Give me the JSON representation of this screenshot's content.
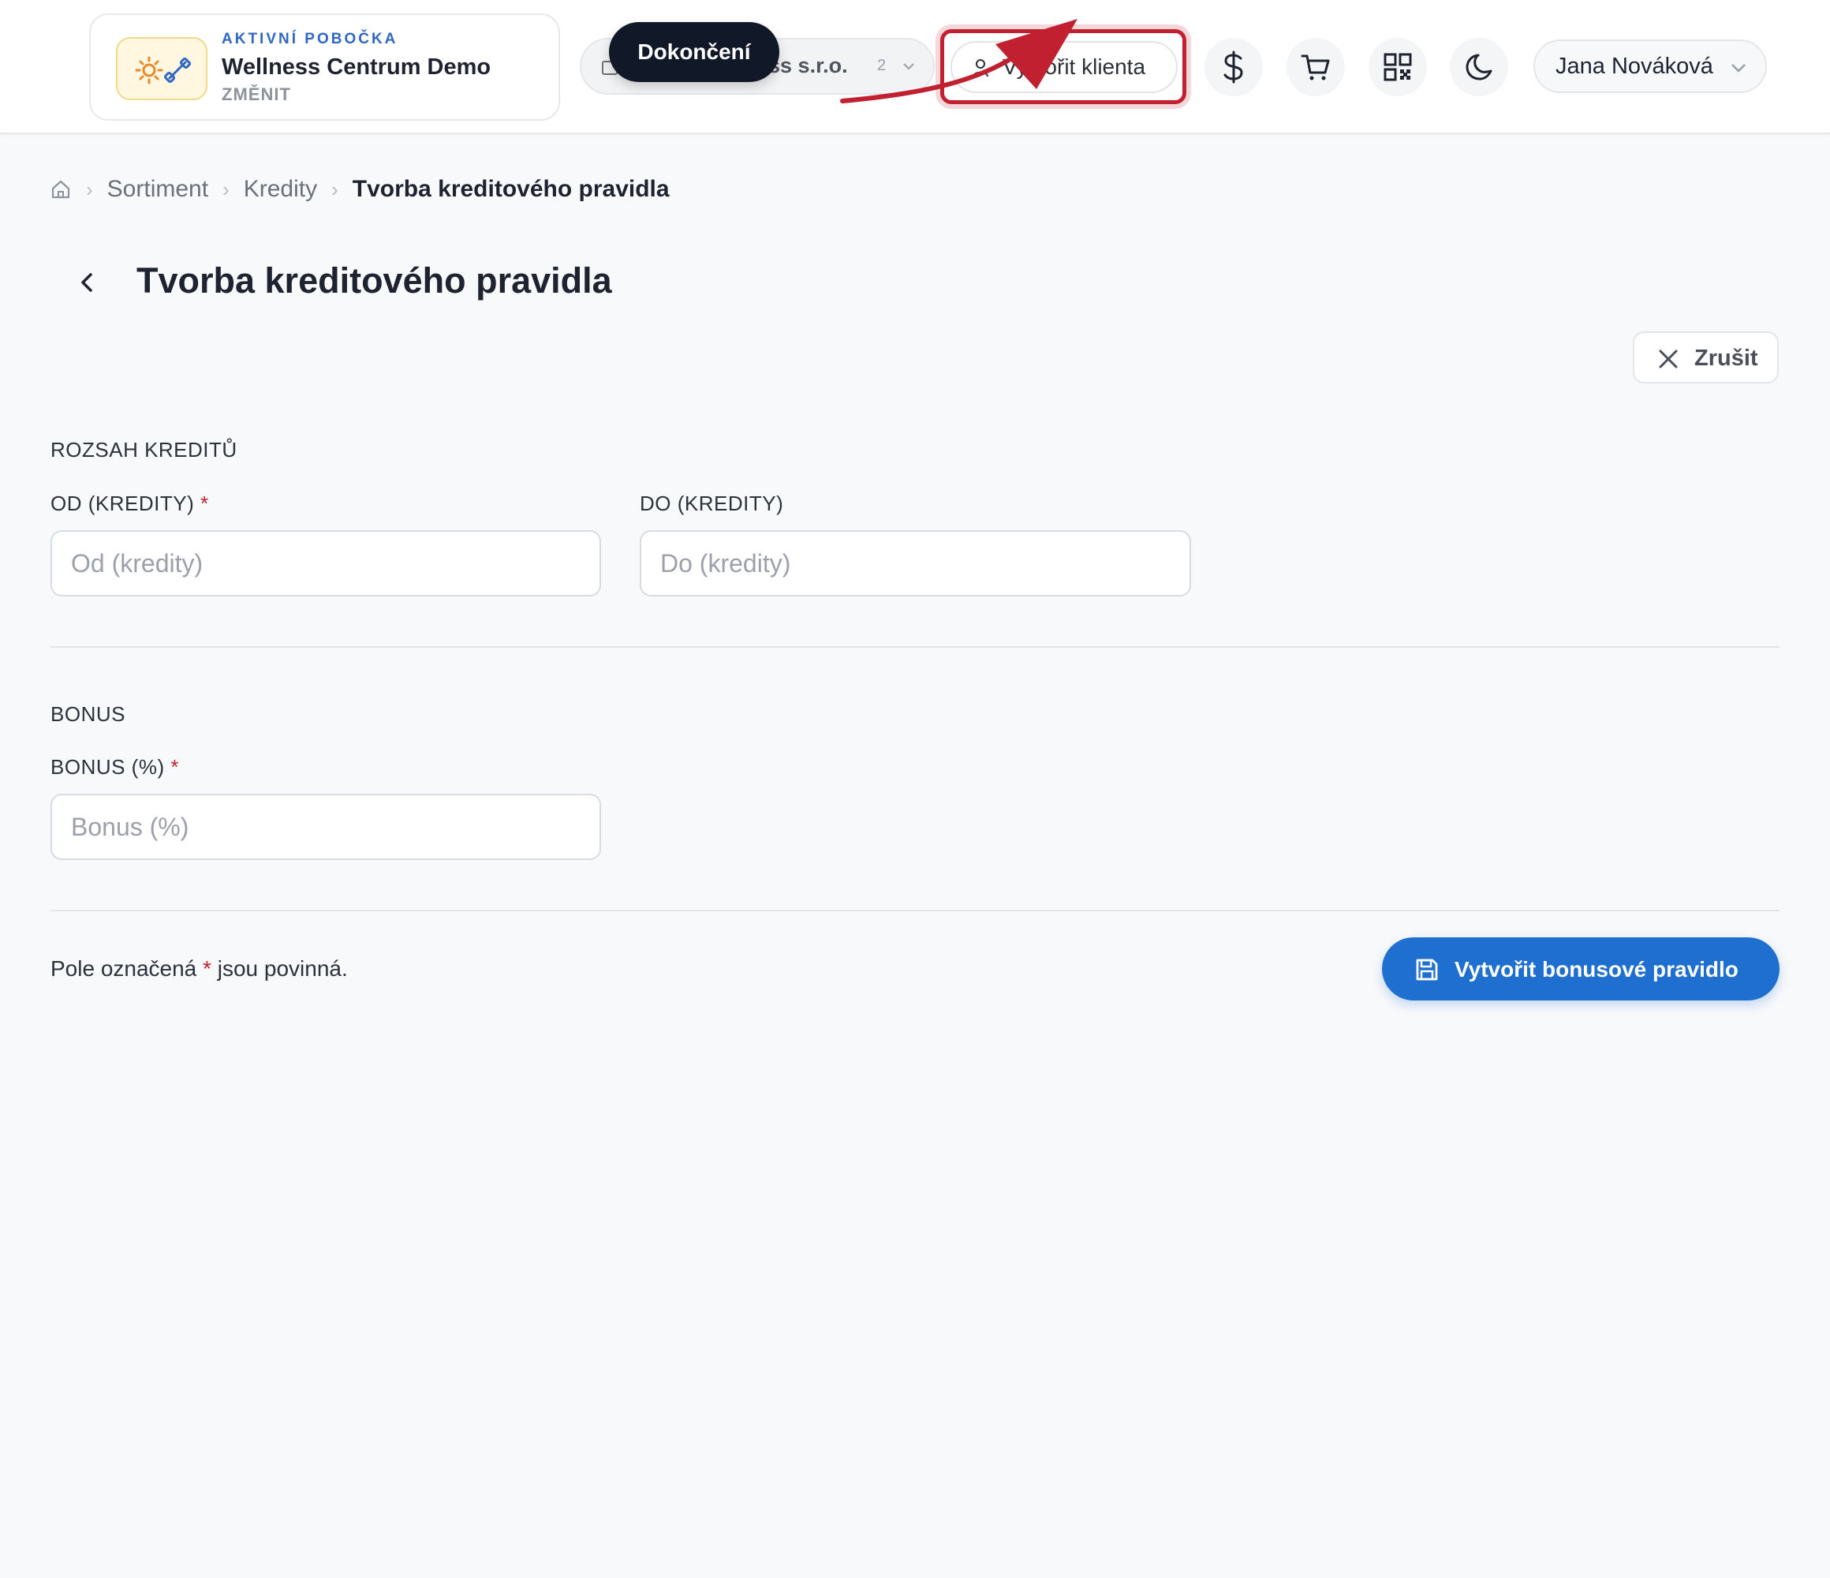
{
  "topbar": {
    "branch": {
      "kicker": "AKTIVNÍ POBOČKA",
      "name": "Wellness Centrum Demo",
      "change_label": "ZMĚNIT"
    },
    "company": {
      "name_visible": "ess s.r.o.",
      "count": "2"
    },
    "tooltip": "Dokončení",
    "create_client_label": "Vytvořit klienta",
    "icon_buttons": [
      "dollar-icon",
      "cart-icon",
      "qr-code-icon",
      "moon-icon"
    ],
    "user_name": "Jana Nováková"
  },
  "breadcrumb": {
    "items": [
      "Sortiment",
      "Kredity"
    ],
    "current": "Tvorba kreditového pravidla"
  },
  "page": {
    "title": "Tvorba kreditového pravidla",
    "cancel_label": "Zrušit"
  },
  "form": {
    "credit_range": {
      "title": "ROZSAH KREDITŮ",
      "from_label": "OD (KREDITY)",
      "from_placeholder": "Od (kredity)",
      "from_value": "",
      "to_label": "DO (KREDITY)",
      "to_placeholder": "Do (kredity)",
      "to_value": ""
    },
    "bonus": {
      "title": "BONUS",
      "bonus_label": "BONUS (%)",
      "bonus_placeholder": "Bonus (%)",
      "bonus_value": ""
    },
    "required_marker": "*",
    "footnote_prefix": "Pole označená",
    "footnote_suffix": "jsou povinná.",
    "submit_label": "Vytvořit bonusové pravidlo"
  },
  "colors": {
    "accent": "#1f6fd1",
    "highlight": "#c0202f",
    "tooltip_bg": "#111827",
    "background": "#f8f9fb"
  }
}
